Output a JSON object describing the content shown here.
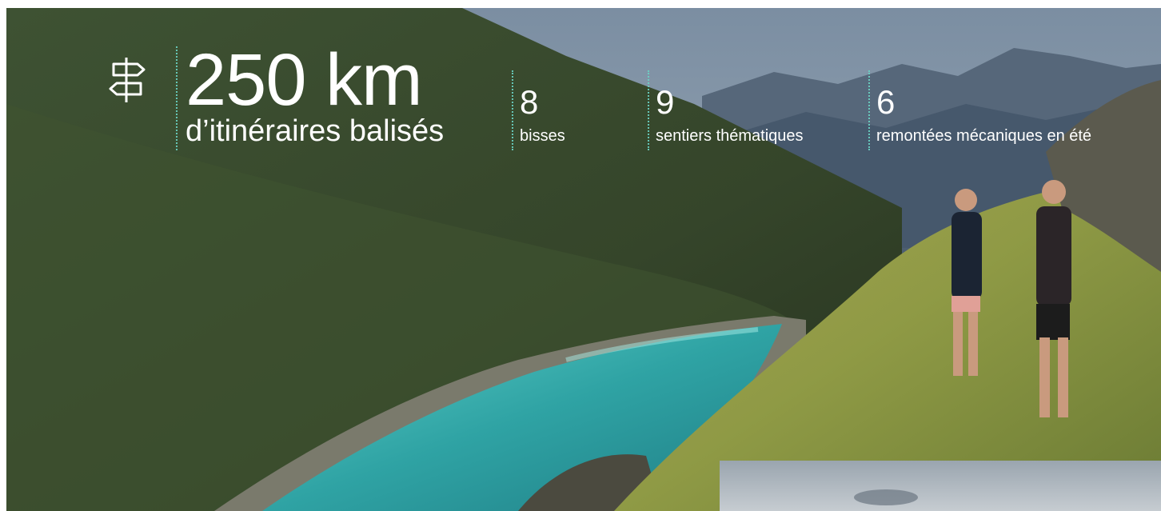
{
  "hero": {
    "icon": "signpost-icon",
    "main_number": "250 km",
    "main_label": "d’itinéraires balisés",
    "stats": [
      {
        "number": "8",
        "label": "bisses"
      },
      {
        "number": "9",
        "label": "sentiers thématiques"
      },
      {
        "number": "6",
        "label": "remontées mécaniques en été"
      }
    ]
  },
  "colors": {
    "accent": "#6ad3c4",
    "text": "#ffffff",
    "lake": "#3fb3b0"
  }
}
